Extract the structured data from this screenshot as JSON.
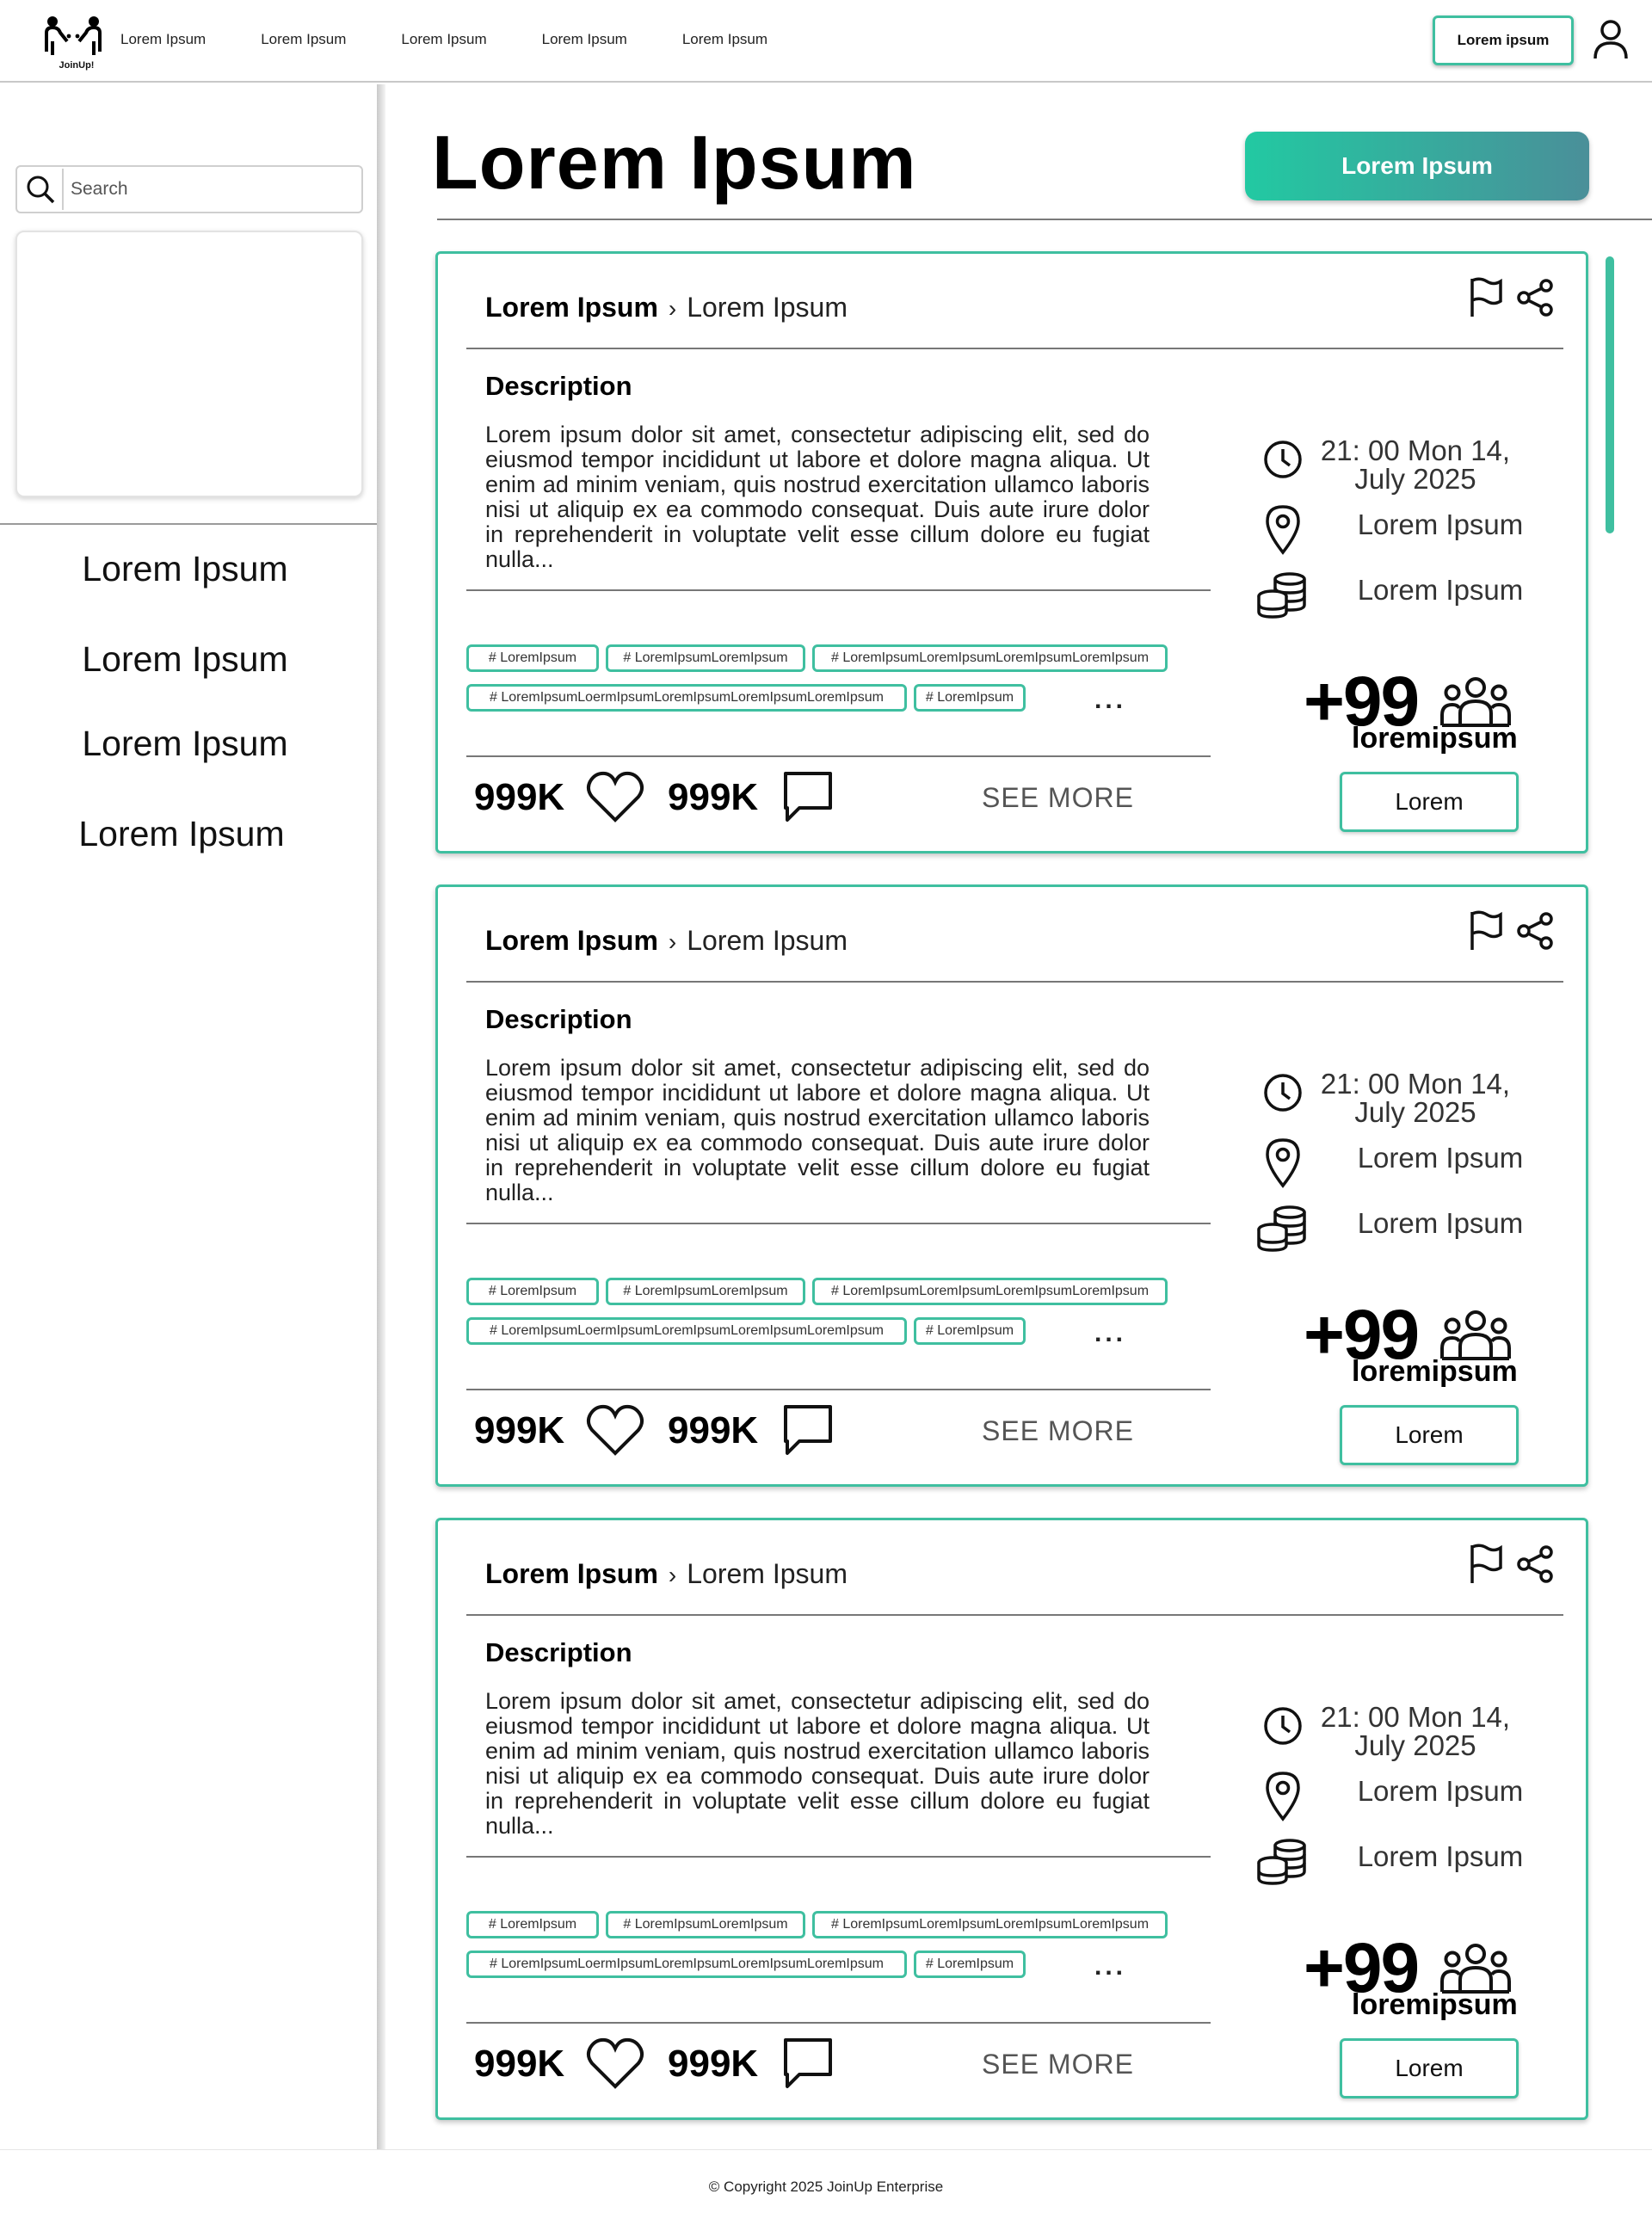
{
  "header": {
    "logo_text": "JoinUp!",
    "nav": [
      "Lorem Ipsum",
      "Lorem Ipsum",
      "Lorem Ipsum",
      "Lorem Ipsum",
      "Lorem Ipsum"
    ],
    "button_label": "Lorem ipsum",
    "user_icon": "user-icon"
  },
  "sidebar": {
    "search_placeholder": "Search",
    "search_icon": "search-icon",
    "items": [
      "Lorem Ipsum",
      "Lorem Ipsum",
      "Lorem Ipsum",
      "Lorem Ipsum"
    ]
  },
  "main": {
    "title": "Lorem Ipsum",
    "primary_button": "Lorem Ipsum",
    "accent_color": "#3fbfa0",
    "gradient": [
      "#22c9a2",
      "#4a8f99"
    ]
  },
  "events": [
    {
      "category": "Lorem Ipsum",
      "subcategory": "Lorem Ipsum",
      "desc_title": "Description",
      "description": "Lorem ipsum dolor sit amet, consectetur adipiscing elit, sed do eiusmod tempor incididunt ut labore et dolore magna aliqua. Ut enim ad minim veniam, quis nostrud exercitation ullamco laboris nisi ut aliquip ex ea commodo consequat. Duis aute irure dolor in reprehenderit in voluptate velit esse cillum dolore eu fugiat nulla...",
      "tags": [
        "# LoremIpsum",
        "# LoremIpsumLoremIpsum",
        "# LoremIpsumLoremIpsumLoremIpsumLoremIpsum",
        "# LoremIpsumLoermIpsumLoremIpsumLoremIpsumLoremIpsum",
        "# LoremIpsum"
      ],
      "tags_more": "...",
      "likes": "999K",
      "comments": "999K",
      "see_more": "SEE MORE",
      "datetime": "21: 00 Mon 14, July 2025",
      "location": "Lorem Ipsum",
      "price": "Lorem Ipsum",
      "participants": "+99",
      "participants_label": "loremipsum",
      "join_label": "Lorem"
    },
    {
      "category": "Lorem Ipsum",
      "subcategory": "Lorem Ipsum",
      "desc_title": "Description",
      "description": "Lorem ipsum dolor sit amet, consectetur adipiscing elit, sed do eiusmod tempor incididunt ut labore et dolore magna aliqua. Ut enim ad minim veniam, quis nostrud exercitation ullamco laboris nisi ut aliquip ex ea commodo consequat. Duis aute irure dolor in reprehenderit in voluptate velit esse cillum dolore eu fugiat nulla...",
      "tags": [
        "# LoremIpsum",
        "# LoremIpsumLoremIpsum",
        "# LoremIpsumLoremIpsumLoremIpsumLoremIpsum",
        "# LoremIpsumLoermIpsumLoremIpsumLoremIpsumLoremIpsum",
        "# LoremIpsum"
      ],
      "tags_more": "...",
      "likes": "999K",
      "comments": "999K",
      "see_more": "SEE MORE",
      "datetime": "21: 00 Mon 14, July 2025",
      "location": "Lorem Ipsum",
      "price": "Lorem Ipsum",
      "participants": "+99",
      "participants_label": "loremipsum",
      "join_label": "Lorem"
    },
    {
      "category": "Lorem Ipsum",
      "subcategory": "Lorem Ipsum",
      "desc_title": "Description",
      "description": "Lorem ipsum dolor sit amet, consectetur adipiscing elit, sed do eiusmod tempor incididunt ut labore et dolore magna aliqua. Ut enim ad minim veniam, quis nostrud exercitation ullamco laboris nisi ut aliquip ex ea commodo consequat. Duis aute irure dolor in reprehenderit in voluptate velit esse cillum dolore eu fugiat nulla...",
      "tags": [
        "# LoremIpsum",
        "# LoremIpsumLoremIpsum",
        "# LoremIpsumLoremIpsumLoremIpsumLoremIpsum",
        "# LoremIpsumLoermIpsumLoremIpsumLoremIpsumLoremIpsum",
        "# LoremIpsum"
      ],
      "tags_more": "...",
      "likes": "999K",
      "comments": "999K",
      "see_more": "SEE MORE",
      "datetime": "21: 00 Mon 14, July 2025",
      "location": "Lorem Ipsum",
      "price": "Lorem Ipsum",
      "participants": "+99",
      "participants_label": "loremipsum",
      "join_label": "Lorem"
    }
  ],
  "footer": {
    "copyright": "© Copyright 2025 JoinUp Enterprise"
  }
}
